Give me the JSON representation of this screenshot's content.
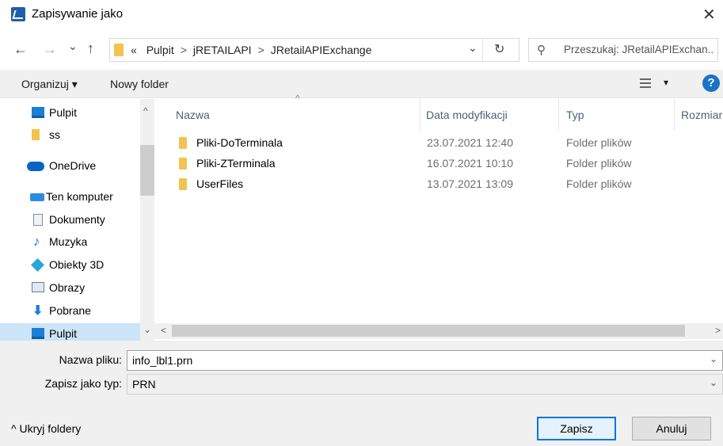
{
  "window": {
    "title": "Zapisywanie jako",
    "close_glyph": "✕"
  },
  "nav": {
    "back_glyph": "←",
    "forward_glyph": "→",
    "recent_glyph": "⌄",
    "up_glyph": "↑",
    "breadcrumb_overflow": "«",
    "breadcrumbs": [
      "Pulpit",
      "jRETAILAPI",
      "JRetailAPIExchange"
    ],
    "dropdown_glyph": "⌄",
    "refresh_glyph": "↻",
    "search_placeholder": "Przeszukaj: JRetailAPIExchan..."
  },
  "toolbar": {
    "organize": "Organizuj ▾",
    "new_folder": "Nowy folder",
    "view_caret": "▾",
    "help": "?"
  },
  "sidebar": {
    "items": [
      {
        "label": "Pulpit",
        "icon": "desktop-icon"
      },
      {
        "label": "ss",
        "icon": "folder-icon"
      },
      {
        "label": "OneDrive",
        "icon": "cloud-icon"
      },
      {
        "label": "Ten komputer",
        "icon": "computer-icon"
      },
      {
        "label": "Dokumenty",
        "icon": "documents-icon"
      },
      {
        "label": "Muzyka",
        "icon": "music-icon"
      },
      {
        "label": "Obiekty 3D",
        "icon": "3d-objects-icon"
      },
      {
        "label": "Obrazy",
        "icon": "pictures-icon"
      },
      {
        "label": "Pobrane",
        "icon": "downloads-icon"
      },
      {
        "label": "Pulpit",
        "icon": "desktop-icon"
      }
    ],
    "scroll_up": "^",
    "scroll_down": "⌄"
  },
  "list": {
    "columns": {
      "name": "Nazwa",
      "date": "Data modyfikacji",
      "type": "Typ",
      "size": "Rozmiar"
    },
    "sort_glyph": "^",
    "rows": [
      {
        "name": "Pliki-DoTerminala",
        "date": "23.07.2021 12:40",
        "type": "Folder plików"
      },
      {
        "name": "Pliki-ZTerminala",
        "date": "16.07.2021 10:10",
        "type": "Folder plików"
      },
      {
        "name": "UserFiles",
        "date": "13.07.2021 13:09",
        "type": "Folder plików"
      }
    ],
    "scroll_left": "<",
    "scroll_right": ">"
  },
  "form": {
    "filename_label": "Nazwa pliku:",
    "filename_value": "info_lbl1.prn",
    "filetype_label": "Zapisz jako typ:",
    "filetype_value": "PRN",
    "combo_glyph": "⌄"
  },
  "footer": {
    "hide_folders": "^ Ukryj foldery",
    "save": "Zapisz",
    "cancel": "Anuluj"
  },
  "colors": {
    "accent": "#0078d7",
    "folder": "#f3c24f",
    "selected": "#cce4f7"
  }
}
